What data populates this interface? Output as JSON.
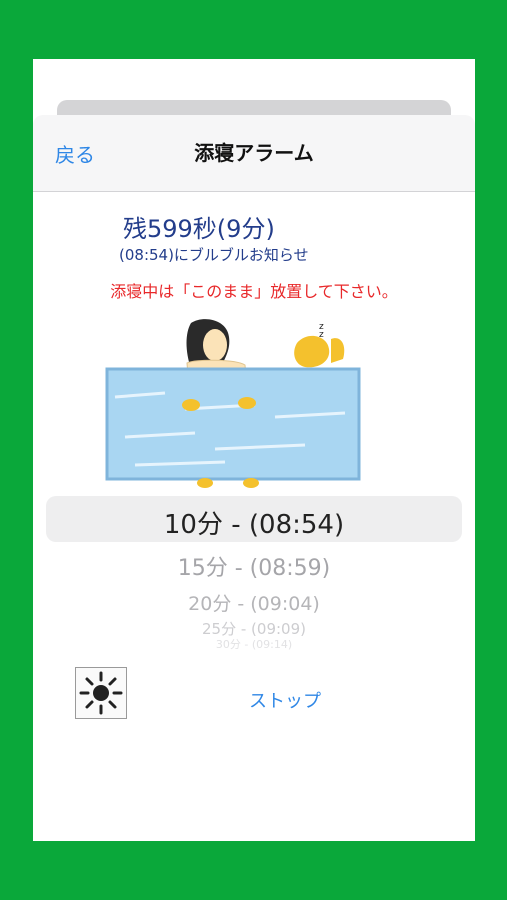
{
  "nav": {
    "back_label": "戻る",
    "title": "添寝アラーム"
  },
  "timer": {
    "remaining": "残599秒(9分)",
    "notify": "(08:54)にブルブルお知らせ",
    "warning": "添寝中は「このまま」放置して下さい。"
  },
  "picker": {
    "options": [
      "10分 - (08:54)",
      "15分 - (08:59)",
      "20分 - (09:04)",
      "25分 - (09:09)",
      "30分 - (09:14)"
    ],
    "selected_index": 0
  },
  "controls": {
    "stop_label": "ストップ",
    "brightness_icon": "sun-icon"
  },
  "colors": {
    "background": "#0aa83a",
    "link": "#2f87e6",
    "warning": "#e8282a",
    "text": "#233d8b"
  }
}
